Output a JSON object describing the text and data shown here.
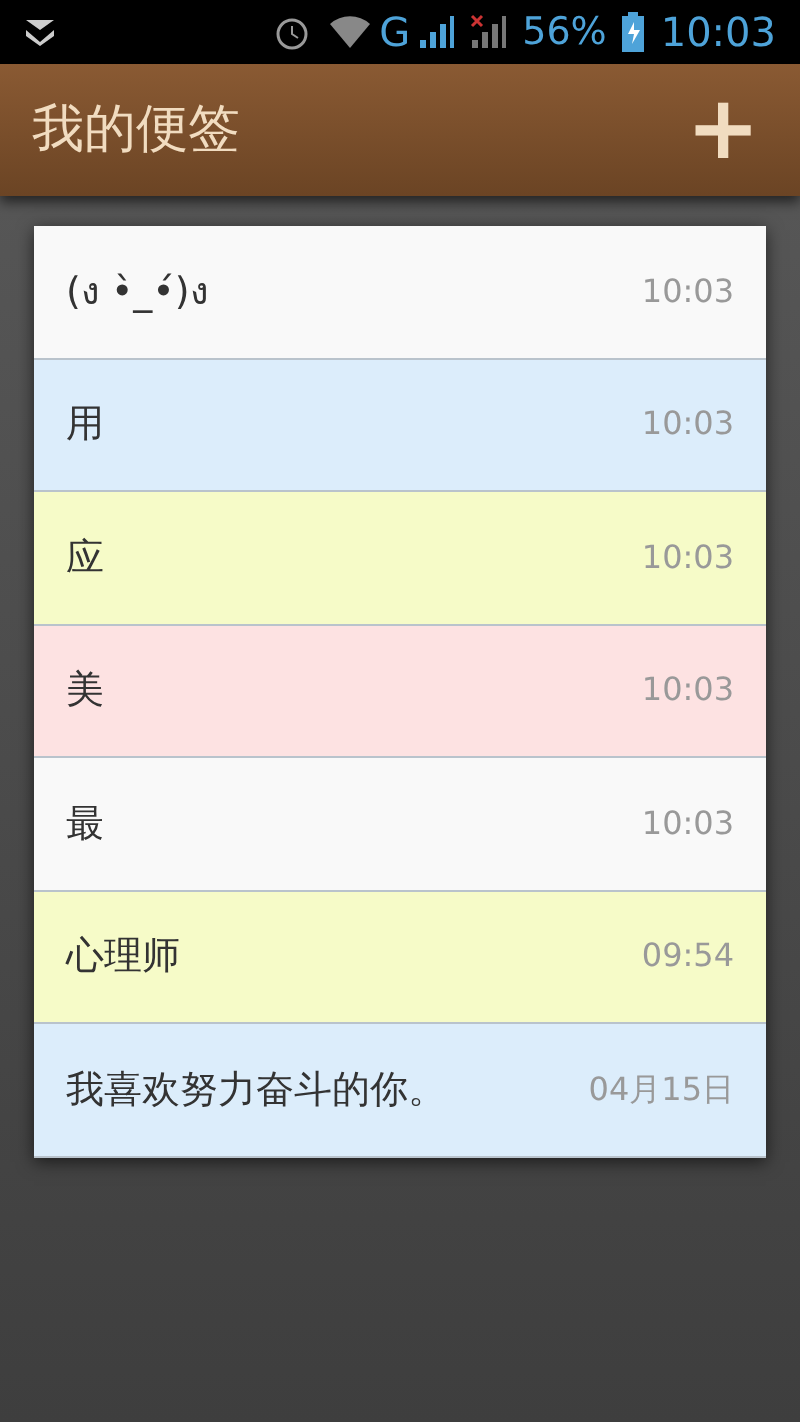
{
  "status_bar": {
    "battery": "56%",
    "time": "10:03",
    "network": "G"
  },
  "header": {
    "title": "我的便签",
    "add": "+"
  },
  "notes": [
    {
      "text": "(ง •̀_•́)ง",
      "time": "10:03",
      "color": "#f9f9f9"
    },
    {
      "text": "用",
      "time": "10:03",
      "color": "#dcedfb"
    },
    {
      "text": "应",
      "time": "10:03",
      "color": "#f6fbc8"
    },
    {
      "text": "美",
      "time": "10:03",
      "color": "#fde2e2"
    },
    {
      "text": "最",
      "time": "10:03",
      "color": "#f9f9f9"
    },
    {
      "text": "心理师",
      "time": "09:54",
      "color": "#f6fbc8"
    },
    {
      "text": "我喜欢努力奋斗的你。",
      "time": "04月15日",
      "color": "#dcedfb"
    }
  ]
}
